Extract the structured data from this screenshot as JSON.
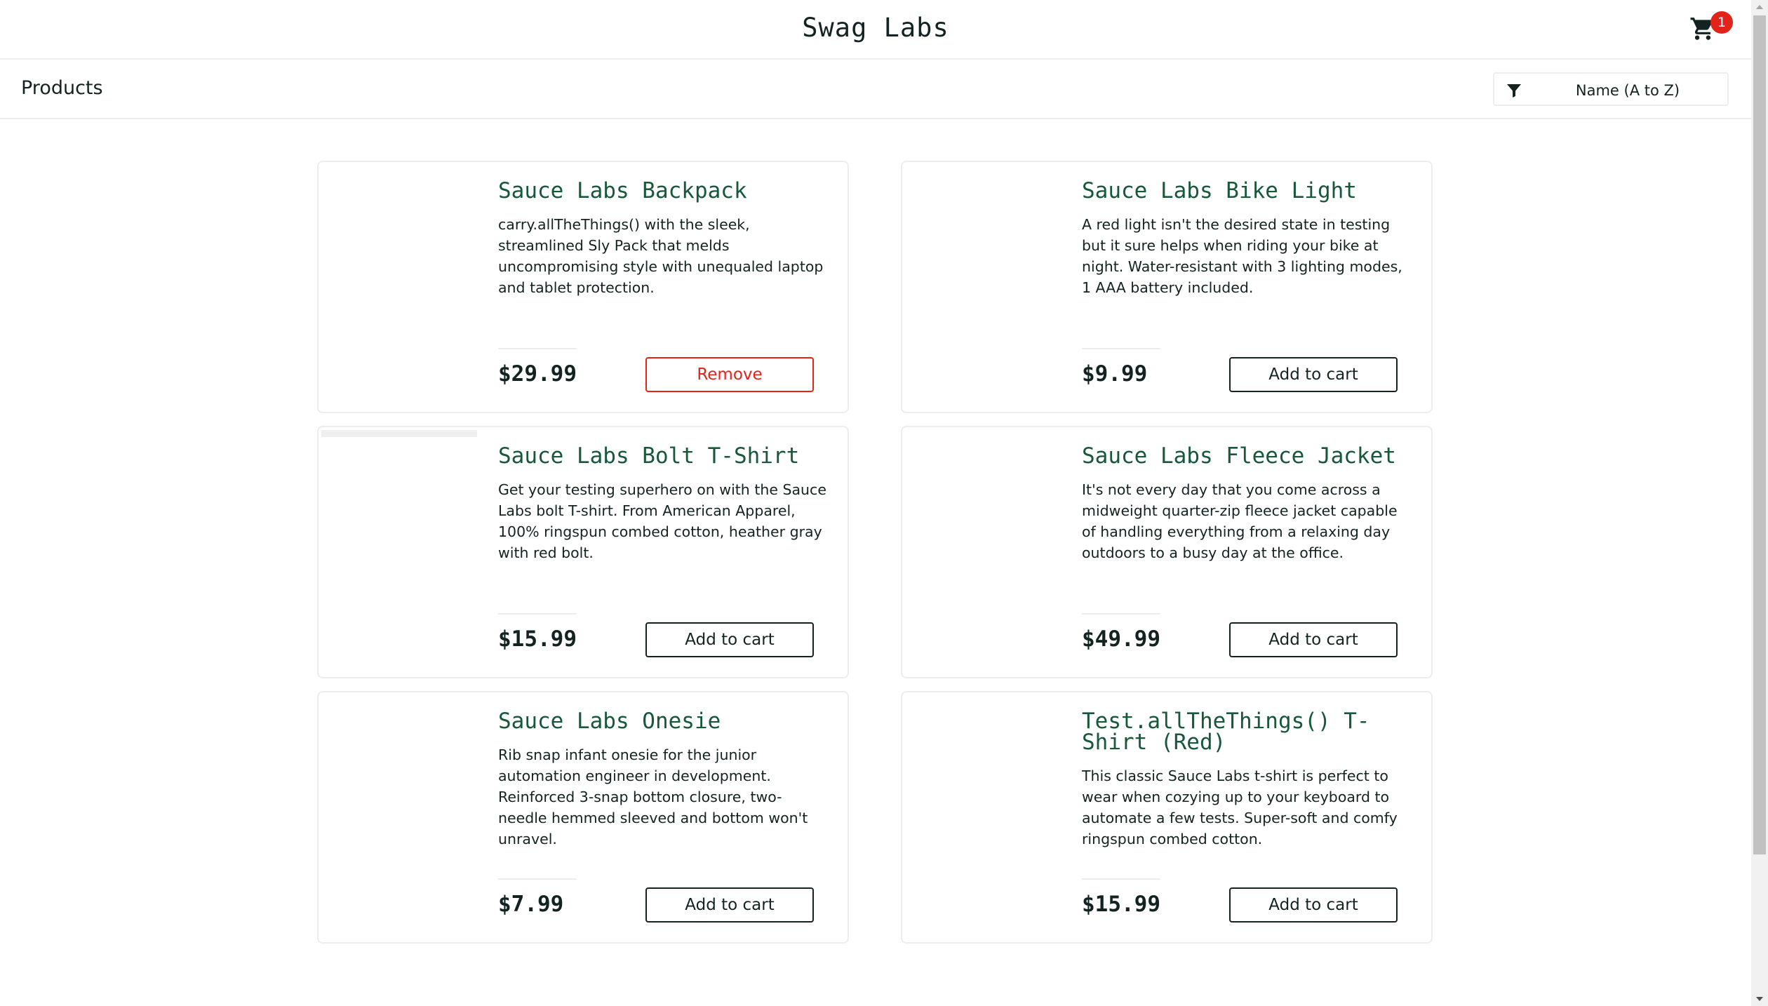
{
  "header": {
    "app_logo": "Swag Labs",
    "cart_badge": "1",
    "cart_icon": "shopping-cart-icon"
  },
  "subheader": {
    "title": "Products",
    "sort": {
      "icon": "filter-icon",
      "selected": "Name (A to Z)"
    }
  },
  "products": [
    {
      "name": "Sauce Labs Backpack",
      "description": "carry.allTheThings() with the sleek, streamlined Sly Pack that melds uncompromising style with unequaled laptop and tablet protection.",
      "price": "$29.99",
      "button": "Remove"
    },
    {
      "name": "Sauce Labs Bike Light",
      "description": "A red light isn't the desired state in testing but it sure helps when riding your bike at night. Water-resistant with 3 lighting modes, 1 AAA battery included.",
      "price": "$9.99",
      "button": "Add to cart"
    },
    {
      "name": "Sauce Labs Bolt T-Shirt",
      "description": "Get your testing superhero on with the Sauce Labs bolt T-shirt. From American Apparel, 100% ringspun combed cotton, heather gray with red bolt.",
      "price": "$15.99",
      "button": "Add to cart"
    },
    {
      "name": "Sauce Labs Fleece Jacket",
      "description": "It's not every day that you come across a midweight quarter-zip fleece jacket capable of handling everything from a relaxing day outdoors to a busy day at the office.",
      "price": "$49.99",
      "button": "Add to cart"
    },
    {
      "name": "Sauce Labs Onesie",
      "description": "Rib snap infant onesie for the junior automation engineer in development. Reinforced 3-snap bottom closure, two-needle hemmed sleeved and bottom won't unravel.",
      "price": "$7.99",
      "button": "Add to cart"
    },
    {
      "name": "Test.allTheThings() T-Shirt (Red)",
      "description": "This classic Sauce Labs t-shirt is perfect to wear when cozying up to your keyboard to automate a few tests. Super-soft and comfy ringspun combed cotton.",
      "price": "$15.99",
      "button": "Add to cart"
    }
  ],
  "colors": {
    "product_name": "#18583a",
    "badge": "#e2231a",
    "remove_button": "#e2231a",
    "text": "#132322"
  }
}
